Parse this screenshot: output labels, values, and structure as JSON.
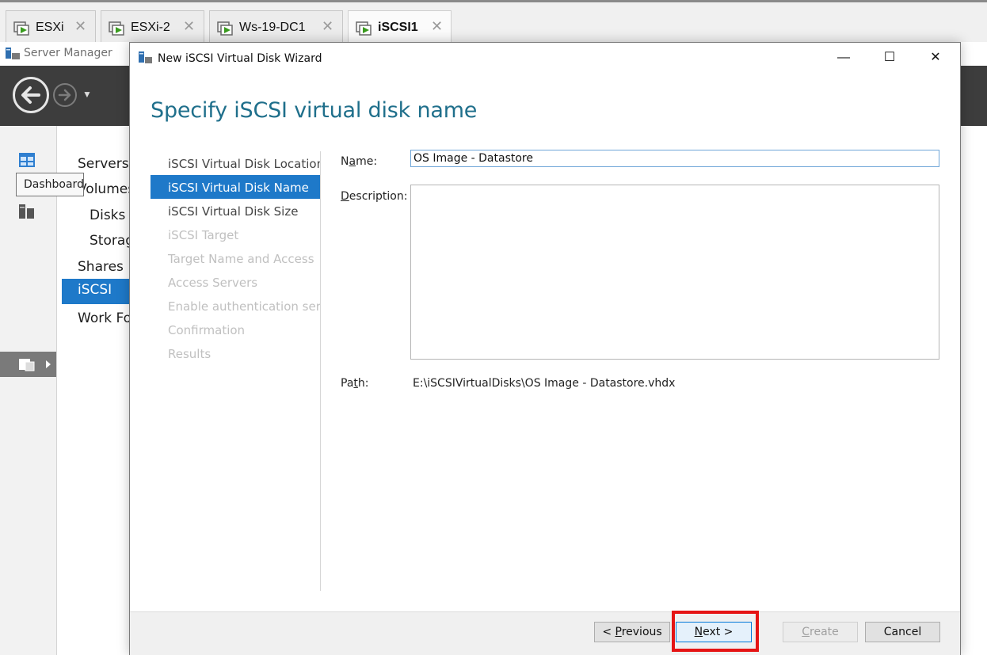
{
  "vm_tabs": [
    {
      "label": "ESXi"
    },
    {
      "label": "ESXi-2"
    },
    {
      "label": "Ws-19-DC1"
    },
    {
      "label": "iSCSI1"
    }
  ],
  "server_manager": {
    "title": "Server Manager",
    "tooltip": "Dashboard",
    "nav": {
      "servers": "Servers",
      "volumes": "Volumes",
      "disks": "Disks",
      "storage_pools": "Storag",
      "shares": "Shares",
      "iscsi": "iSCSI",
      "work_folders": "Work Fo"
    }
  },
  "wizard": {
    "title": "New iSCSI Virtual Disk Wizard",
    "heading": "Specify iSCSI virtual disk name",
    "window_buttons": {
      "minimize": "—",
      "maximize": "☐",
      "close": "✕"
    },
    "steps": [
      {
        "label": "iSCSI Virtual Disk Location",
        "state": "done"
      },
      {
        "label": "iSCSI Virtual Disk Name",
        "state": "selected"
      },
      {
        "label": "iSCSI Virtual Disk Size",
        "state": "enabled"
      },
      {
        "label": "iSCSI Target",
        "state": "disabled"
      },
      {
        "label": "Target Name and Access",
        "state": "disabled"
      },
      {
        "label": "Access Servers",
        "state": "disabled"
      },
      {
        "label": "Enable authentication ser...",
        "state": "disabled"
      },
      {
        "label": "Confirmation",
        "state": "disabled"
      },
      {
        "label": "Results",
        "state": "disabled"
      }
    ],
    "form": {
      "name_label_pre": "N",
      "name_label_ul": "a",
      "name_label_post": "me:",
      "name_value": "OS Image - Datastore",
      "description_label_pre": "",
      "description_label_ul": "D",
      "description_label_post": "escription:",
      "description_value": "",
      "path_label_pre": "Pa",
      "path_label_ul": "t",
      "path_label_post": "h:",
      "path_value": "E:\\iSCSIVirtualDisks\\OS Image - Datastore.vhdx"
    },
    "buttons": {
      "previous_pre": "< ",
      "previous_ul": "P",
      "previous_post": "revious",
      "next_pre": "",
      "next_ul": "N",
      "next_post": "ext >",
      "create_pre": "",
      "create_ul": "C",
      "create_post": "reate",
      "cancel": "Cancel"
    }
  },
  "colors": {
    "accent_blue": "#1e79c9",
    "heading_teal": "#1f6f8b",
    "highlight_red": "#e51414",
    "header_dark": "#3d3d3d"
  }
}
